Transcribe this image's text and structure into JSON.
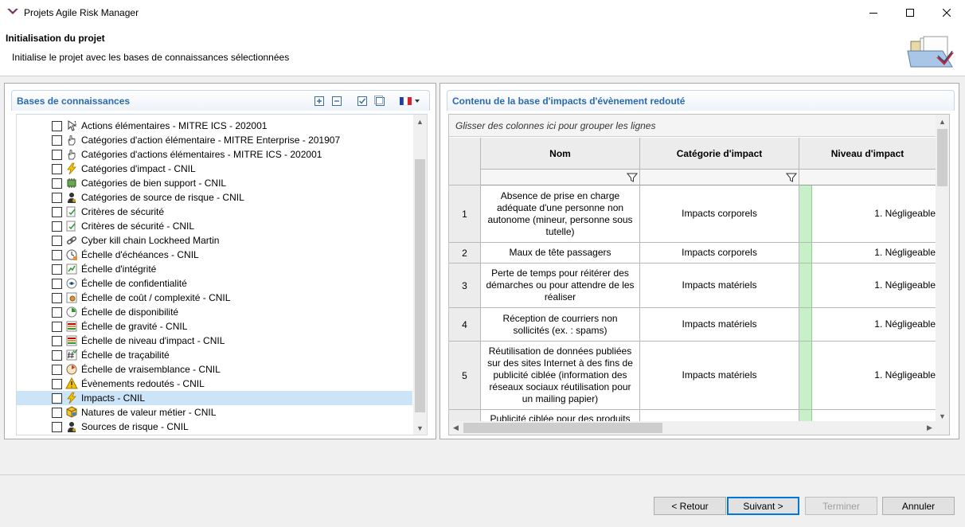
{
  "window": {
    "title": "Projets Agile Risk Manager",
    "colors": {
      "accent": "#2a6ab0",
      "selection": "#cce4f7",
      "level_green": "#c8f0c8"
    }
  },
  "wizard": {
    "title": "Initialisation du projet",
    "description": "Initialise le projet avec les bases de connaissances sélectionnées"
  },
  "left_panel": {
    "title": "Bases de connaissances",
    "tools": [
      "expand-all-icon",
      "collapse-all-icon",
      "check-all-icon",
      "uncheck-all-icon",
      "french-flag-icon"
    ],
    "items": [
      {
        "label": "Actions élémentaires - MITRE ICS - 202001",
        "icon": "cursor-icon",
        "checked": false
      },
      {
        "label": "Catégories d'action élémentaire - MITRE Enterprise - 201907",
        "icon": "hand-icon",
        "checked": false
      },
      {
        "label": "Catégories d'actions élémentaires - MITRE ICS - 202001",
        "icon": "hand-icon",
        "checked": false
      },
      {
        "label": "Catégories d'impact - CNIL",
        "icon": "lightning-icon",
        "checked": false
      },
      {
        "label": "Catégories de bien support - CNIL",
        "icon": "chip-icon",
        "checked": false
      },
      {
        "label": "Catégories de source de risque - CNIL",
        "icon": "person-icon",
        "checked": false
      },
      {
        "label": "Critères de sécurité",
        "icon": "criteria-icon",
        "checked": false
      },
      {
        "label": "Critères de sécurité - CNIL",
        "icon": "criteria-icon",
        "checked": false
      },
      {
        "label": "Cyber kill chain Lockheed Martin",
        "icon": "chain-icon",
        "checked": false
      },
      {
        "label": "Échelle d'échéances - CNIL",
        "icon": "clock-icon",
        "checked": false
      },
      {
        "label": "Échelle d'intégrité",
        "icon": "scale-icon",
        "checked": false
      },
      {
        "label": "Échelle de confidentialité",
        "icon": "eye-icon",
        "checked": false
      },
      {
        "label": "Échelle de coût / complexité - CNIL",
        "icon": "cost-icon",
        "checked": false
      },
      {
        "label": "Échelle de disponibilité",
        "icon": "availability-icon",
        "checked": false
      },
      {
        "label": "Échelle de gravité - CNIL",
        "icon": "bars-icon",
        "checked": false
      },
      {
        "label": "Échelle de niveau d'impact - CNIL",
        "icon": "bars-icon",
        "checked": false
      },
      {
        "label": "Échelle de traçabilité",
        "icon": "hash-icon",
        "checked": false
      },
      {
        "label": "Échelle de vraisemblance - CNIL",
        "icon": "dice-icon",
        "checked": false
      },
      {
        "label": "Évènements redoutés - CNIL",
        "icon": "warning-icon",
        "checked": false
      },
      {
        "label": "Impacts - CNIL",
        "icon": "lightning-icon",
        "checked": false,
        "selected": true
      },
      {
        "label": "Natures de valeur métier - CNIL",
        "icon": "cube-icon",
        "checked": false
      },
      {
        "label": "Sources de risque - CNIL",
        "icon": "person-icon",
        "checked": false
      }
    ]
  },
  "right_panel": {
    "title": "Contenu de la base d'impacts d'évènement redouté",
    "group_hint": "Glisser des colonnes ici pour grouper les lignes",
    "columns": [
      "Nom",
      "Catégorie d'impact",
      "Niveau d'impact"
    ],
    "rows": [
      {
        "num": "1",
        "nom": "Absence de prise en charge adéquate d'une personne non autonome (mineur, personne sous tutelle)",
        "categorie": "Impacts corporels",
        "niveau": "1. Négligeable"
      },
      {
        "num": "2",
        "nom": "Maux de tête passagers",
        "categorie": "Impacts corporels",
        "niveau": "1. Négligeable"
      },
      {
        "num": "3",
        "nom": "Perte de temps pour réitérer des démarches ou pour attendre de les réaliser",
        "categorie": "Impacts matériels",
        "niveau": "1. Négligeable"
      },
      {
        "num": "4",
        "nom": "Réception de courriers non sollicités (ex. : spams)",
        "categorie": "Impacts matériels",
        "niveau": "1. Négligeable"
      },
      {
        "num": "5",
        "nom": "Réutilisation de données publiées sur des sites Internet à des fins de publicité ciblée (information des réseaux sociaux réutilisation pour un mailing papier)",
        "categorie": "Impacts matériels",
        "niveau": "1. Négligeable"
      },
      {
        "num": "",
        "nom": "Publicité ciblée pour des produits",
        "categorie": "",
        "niveau": ""
      }
    ]
  },
  "buttons": {
    "back": "< Retour",
    "next": "Suivant >",
    "finish": "Terminer",
    "cancel": "Annuler"
  }
}
